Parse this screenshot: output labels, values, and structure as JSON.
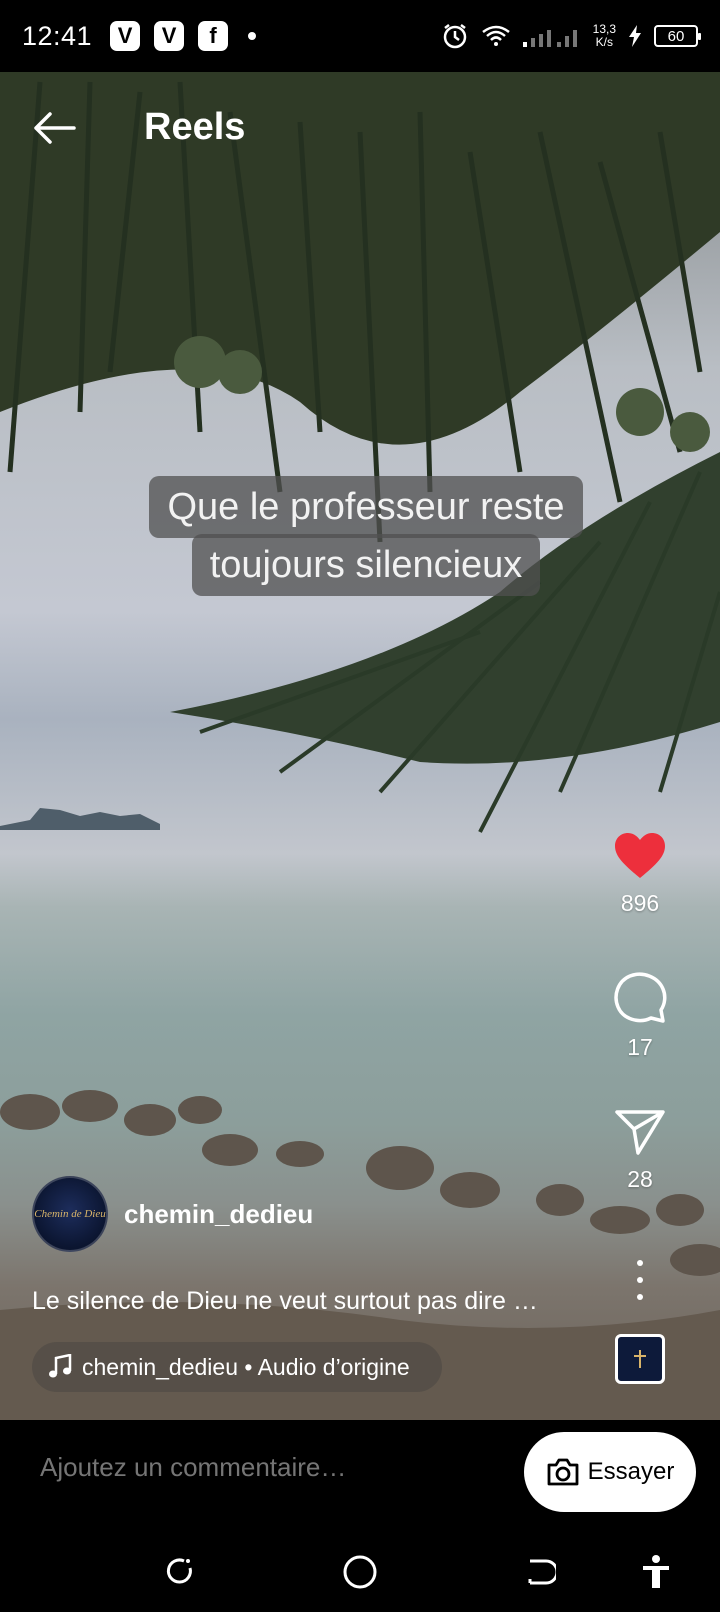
{
  "status_bar": {
    "time": "12:41",
    "app_icons": [
      "V",
      "V",
      "f"
    ],
    "net_speed_value": "13,3",
    "net_speed_unit": "K/s",
    "battery": "60"
  },
  "header": {
    "title": "Reels"
  },
  "video": {
    "caption_line1": "Que le professeur reste",
    "caption_line2": "toujours silencieux"
  },
  "actions": {
    "likes": "896",
    "comments": "17",
    "shares": "28"
  },
  "post": {
    "author": "chemin_dedieu",
    "description": "Le silence de Dieu ne veut surtout pas dire …",
    "audio": "chemin_dedieu • Audio d’origine",
    "avatar_text": "Chemin de Dieu"
  },
  "comment_bar": {
    "placeholder": "Ajoutez un commentaire…",
    "try_label": "Essayer"
  },
  "colors": {
    "like": "#ed2f3c",
    "background": "#000000"
  }
}
